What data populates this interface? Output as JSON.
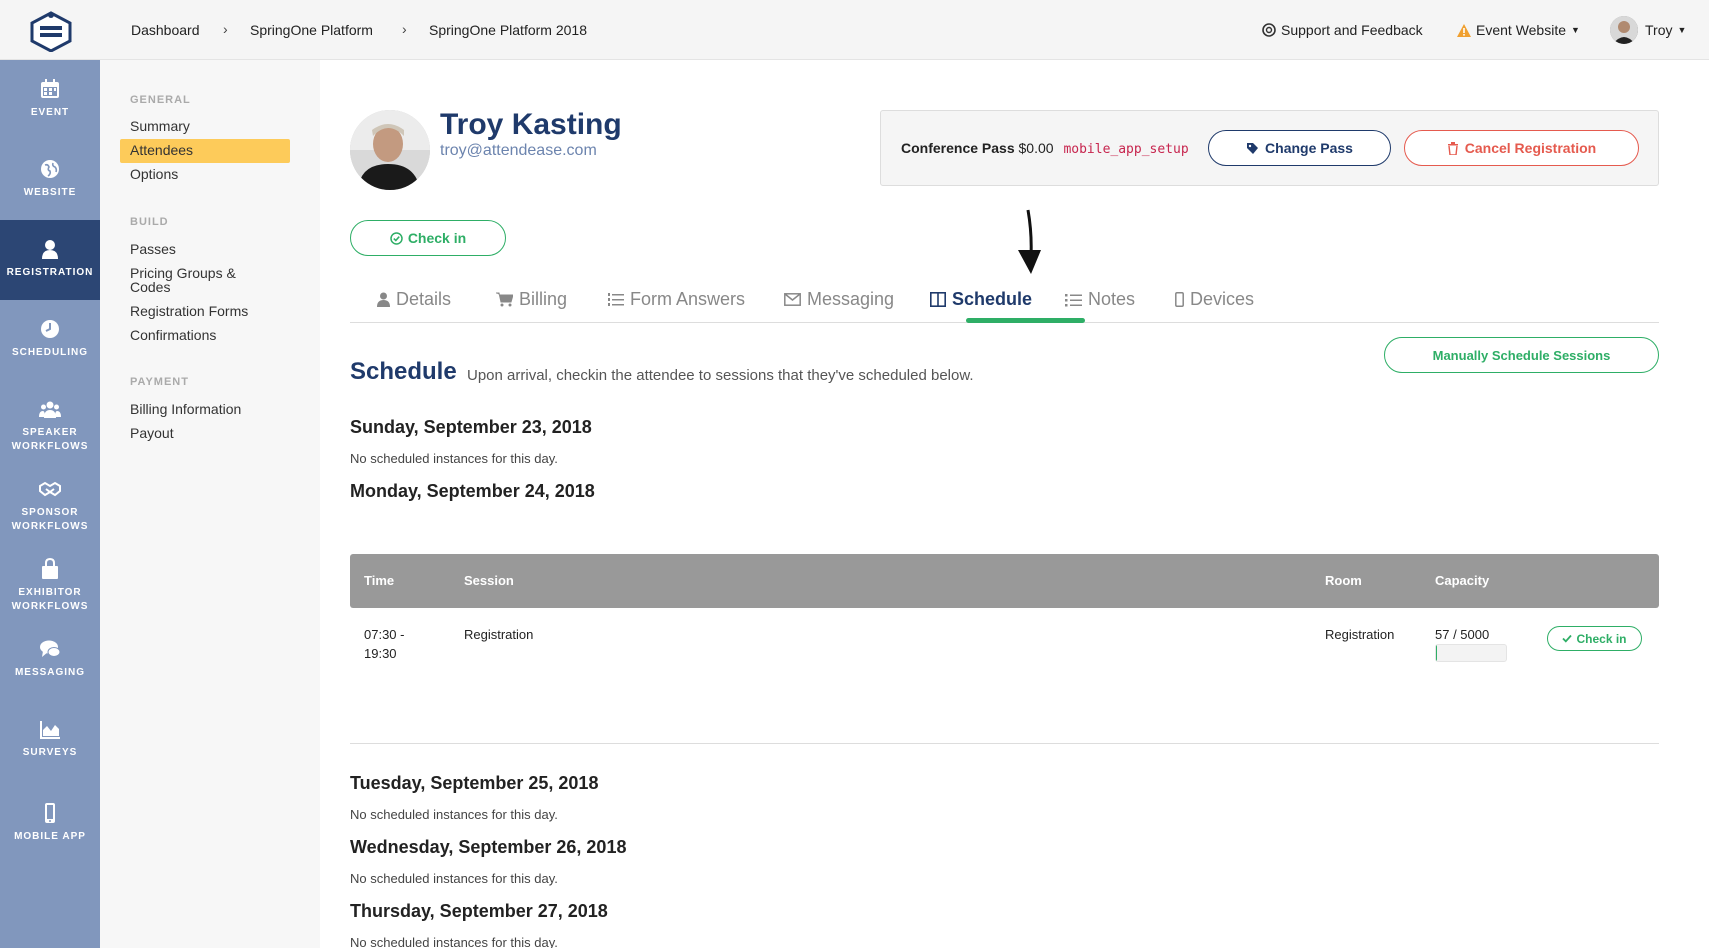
{
  "breadcrumb": [
    "Dashboard",
    "SpringOne Platform",
    "SpringOne Platform 2018"
  ],
  "header": {
    "support": "Support and Feedback",
    "event_website": "Event Website",
    "user": "Troy"
  },
  "nav": [
    {
      "label": "EVENT",
      "icon": "calendar-icon"
    },
    {
      "label": "WEBSITE",
      "icon": "globe-icon"
    },
    {
      "label": "REGISTRATION",
      "icon": "user-icon",
      "active": true
    },
    {
      "label": "SCHEDULING",
      "icon": "clock-icon"
    },
    {
      "label": "SPEAKER",
      "label2": "WORKFLOWS",
      "icon": "users-icon"
    },
    {
      "label": "SPONSOR",
      "label2": "WORKFLOWS",
      "icon": "handshake-icon"
    },
    {
      "label": "EXHIBITOR",
      "label2": "WORKFLOWS",
      "icon": "shopping-bag-icon"
    },
    {
      "label": "MESSAGING",
      "icon": "chat-icon"
    },
    {
      "label": "SURVEYS",
      "icon": "area-chart-icon"
    },
    {
      "label": "MOBILE APP",
      "icon": "mobile-icon"
    }
  ],
  "subnav": {
    "general": {
      "heading": "GENERAL",
      "items": [
        "Summary",
        "Attendees",
        "Options"
      ]
    },
    "build": {
      "heading": "BUILD",
      "items": [
        "Passes",
        "Pricing Groups &",
        "Codes",
        "Registration Forms",
        "Confirmations"
      ]
    },
    "payment": {
      "heading": "PAYMENT",
      "items": [
        "Billing Information",
        "Payout"
      ]
    }
  },
  "attendee": {
    "name": "Troy Kasting",
    "email": "troy@attendease.com"
  },
  "pass": {
    "label": "Conference Pass",
    "price": "$0.00",
    "code": "mobile_app_setup",
    "change_label": "Change Pass",
    "cancel_label": "Cancel Registration"
  },
  "checkin_label": "Check in",
  "tabs": [
    {
      "label": "Details",
      "icon": "user-icon"
    },
    {
      "label": "Billing",
      "icon": "cart-icon"
    },
    {
      "label": "Form Answers",
      "icon": "list-ol-icon"
    },
    {
      "label": "Messaging",
      "icon": "envelope-icon"
    },
    {
      "label": "Schedule",
      "icon": "columns-icon",
      "active": true
    },
    {
      "label": "Notes",
      "icon": "list-icon"
    },
    {
      "label": "Devices",
      "icon": "mobile-icon"
    }
  ],
  "schedule": {
    "title": "Schedule",
    "subtitle": "Upon arrival, checkin the attendee to sessions that they've scheduled below.",
    "manual_label": "Manually Schedule Sessions",
    "columns": [
      "Time",
      "Session",
      "Room",
      "Capacity"
    ],
    "days": [
      {
        "date": "Sunday, September 23, 2018",
        "empty": "No scheduled instances for this day."
      },
      {
        "date": "Monday, September 24, 2018",
        "sessions": [
          {
            "time_start": "07:30 -",
            "time_end": "19:30",
            "session": "Registration",
            "room": "Registration",
            "capacity": "57 / 5000",
            "fill_fraction": 0.0114,
            "checkin": "Check in"
          }
        ]
      },
      {
        "date": "Tuesday, September 25, 2018",
        "empty": "No scheduled instances for this day."
      },
      {
        "date": "Wednesday, September 26, 2018",
        "empty": "No scheduled instances for this day."
      },
      {
        "date": "Thursday, September 27, 2018",
        "empty": "No scheduled instances for this day."
      }
    ]
  },
  "colors": {
    "navy": "#1f3a6b",
    "green": "#2eae66",
    "red": "#e55a4e",
    "sidebar": "#8197bd",
    "sidebar_active": "#2c4674",
    "highlight": "#fdcb5a"
  }
}
